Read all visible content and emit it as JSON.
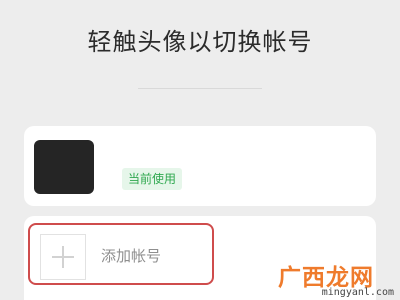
{
  "title": "轻触头像以切换帐号",
  "current_account": {
    "badge": "当前使用"
  },
  "add_account": {
    "label": "添加帐号",
    "icon": "plus-icon"
  },
  "watermark": {
    "text": "广西龙网",
    "url": "mingyanl.com"
  },
  "colors": {
    "background": "#ededed",
    "card": "#ffffff",
    "badge_text": "#2fa84f",
    "badge_bg": "#e6f6ea",
    "highlight_border": "#cf4c4c"
  }
}
